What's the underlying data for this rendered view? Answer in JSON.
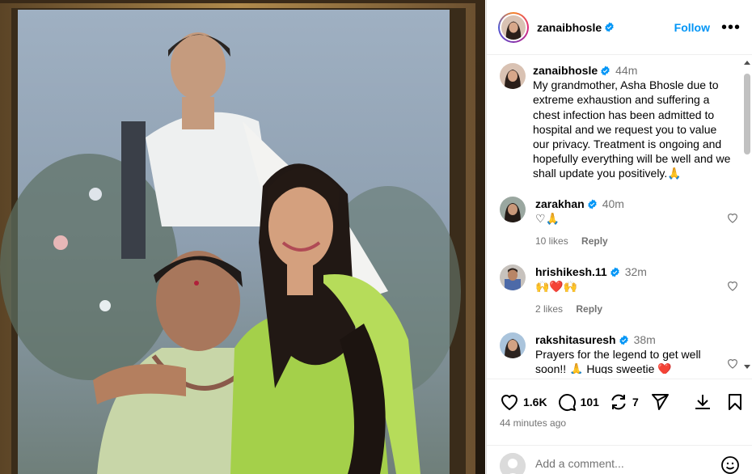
{
  "post": {
    "username": "zanaibhosle",
    "follow_label": "Follow",
    "more_icon": "more-horizontal-icon",
    "caption": {
      "username": "zanaibhosle",
      "time": "44m",
      "text": "My grandmother, Asha Bhosle due to extreme exhaustion and suffering  a chest infection has been admitted to hospital and we request you to value our privacy. Treatment is ongoing and hopefully everything will be well and we shall update you positively.🙏"
    },
    "comments": [
      {
        "username": "zarakhan",
        "time": "40m",
        "text": "♡🙏",
        "likes": "10 likes",
        "reply": "Reply"
      },
      {
        "username": "hrishikesh.11",
        "time": "32m",
        "text": "🙌❤️🙌",
        "likes": "2 likes",
        "reply": "Reply"
      },
      {
        "username": "rakshitasuresh",
        "time": "38m",
        "text": "Prayers for the legend to get well soon!! 🙏 Hugs sweetie ❤️",
        "likes": "",
        "reply": ""
      }
    ],
    "stats": {
      "likes": "1.6K",
      "comments": "101",
      "reposts": "7",
      "time_ago": "44 minutes ago"
    },
    "add_comment_placeholder": "Add a comment...",
    "accent_color": "#0095f6",
    "heart_color": "#ed4956"
  }
}
